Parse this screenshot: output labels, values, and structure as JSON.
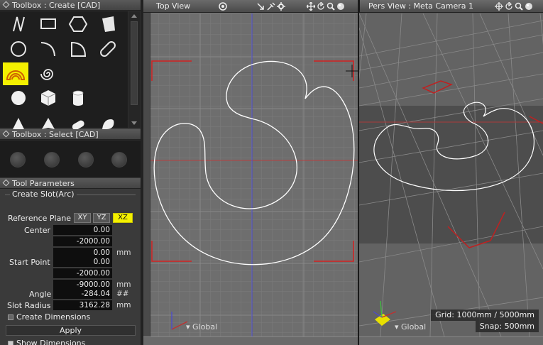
{
  "toolbox_create": {
    "title": "Toolbox : Create [CAD]",
    "tools": [
      {
        "name": "line-icon"
      },
      {
        "name": "rectangle-icon"
      },
      {
        "name": "polygon-icon"
      },
      {
        "name": "parallelogram-icon"
      },
      {
        "name": "circle-icon"
      },
      {
        "name": "arc-icon"
      },
      {
        "name": "sector-icon"
      },
      {
        "name": "slot-icon"
      },
      {
        "name": "slot-arc-icon",
        "active": true
      },
      {
        "name": "spiral-icon"
      },
      {
        "name": "sphere-icon"
      },
      {
        "name": "box-icon"
      },
      {
        "name": "cylinder-icon"
      },
      {
        "name": "cone-icon"
      },
      {
        "name": "pyramid-icon"
      },
      {
        "name": "capsule-icon"
      },
      {
        "name": "torus-icon"
      }
    ],
    "active_color": "#f4f000"
  },
  "toolbox_select": {
    "title": "Toolbox : Select [CAD]"
  },
  "tool_params": {
    "title": "Tool Parameters",
    "group": "Create Slot(Arc)",
    "reference_plane_label": "Reference Plane",
    "planes": [
      "XY",
      "YZ",
      "XZ"
    ],
    "active_plane": "XZ",
    "center_label": "Center",
    "center": [
      "0.00",
      "-2000.00",
      "0.00"
    ],
    "start_point_label": "Start Point",
    "start_point": [
      "0.00",
      "-2000.00",
      "-9000.00"
    ],
    "unit_mm": "mm",
    "angle_label": "Angle",
    "angle": "-284.04",
    "angle_unit": "##",
    "slot_radius_label": "Slot Radius",
    "slot_radius": "3162.28",
    "create_dimensions_label": "Create Dimensions",
    "create_dimensions": false,
    "apply_label": "Apply",
    "show_dimensions_label": "Show Dimensions",
    "show_dimensions": true
  },
  "top_view": {
    "title": "Top View",
    "coordinate_label": "Global"
  },
  "persp_view": {
    "title": "Pers View : Meta Camera 1",
    "coordinate_label": "Global",
    "grid_info": "Grid: 1000mm / 5000mm",
    "snap_info": "Snap: 500mm"
  },
  "colors": {
    "selection_marker": "#d42020",
    "curve": "#ffffff",
    "axis_x": "#c03030",
    "axis_z": "#4040c8"
  }
}
